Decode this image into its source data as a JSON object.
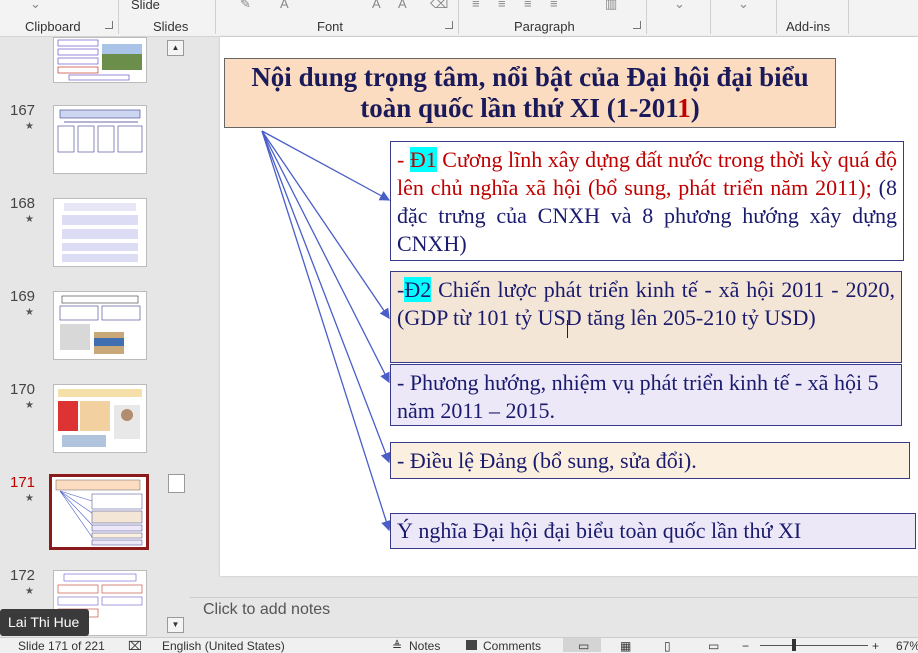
{
  "ribbon": {
    "groups": [
      "Clipboard",
      "Slides",
      "Font",
      "Paragraph",
      "Add-ins"
    ],
    "slide_button": "Slide"
  },
  "thumbnails": [
    {
      "number": "",
      "star": ""
    },
    {
      "number": "167",
      "star": "★"
    },
    {
      "number": "168",
      "star": "★"
    },
    {
      "number": "169",
      "star": "★"
    },
    {
      "number": "170",
      "star": "★"
    },
    {
      "number": "171",
      "star": "★"
    },
    {
      "number": "172",
      "star": "★"
    }
  ],
  "slide": {
    "title_line1": "Nội dung trọng tâm, nổi bật của Đại hội đại biểu",
    "title_line2a": "toàn quốc lần thứ XI (1-201",
    "title_line2b": "1",
    "title_line2c": ")",
    "box1_tag": "Đ1",
    "box1_prefix": "- ",
    "box1_text_a": " Cương lĩnh xây dựng đất nước trong thời kỳ quá độ lên chủ nghĩa xã hội (bổ sung, phát triển năm 2011);",
    "box1_text_b": " (8 đặc trưng của CNXH và 8 phương hướng xây dựng CNXH)",
    "box2_prefix": "-",
    "box2_tag": "Đ2",
    "box2_text": " Chiến lược phát triển kinh tế - xã hội 2011 - 2020, (GDP từ 101 tỷ USD tăng lên 205-210 tỷ USD)",
    "box3_text": "- Phương hướng, nhiệm vụ phát triển kinh tế - xã hội 5 năm 2011 – 2015.",
    "box4_text": "- Điều lệ Đảng (bổ sung, sửa đổi).",
    "box5_text": "Ý nghĩa Đại hội đại biểu toàn quốc lần thứ XI"
  },
  "notes_placeholder": "Click to add notes",
  "status": {
    "slide_counter": "Slide 171 of 221",
    "language": "English (United States)",
    "notes": "Notes",
    "comments": "Comments",
    "zoom": "67%"
  },
  "user_label": "Lai Thi Hue",
  "colors": {
    "selected_thumb_border": "#8b1a1a",
    "title_fill": "#fbdcc0",
    "box_fill": "#f0ecf8",
    "highlight": "#00ffff",
    "arrow": "#4a5ec8"
  }
}
